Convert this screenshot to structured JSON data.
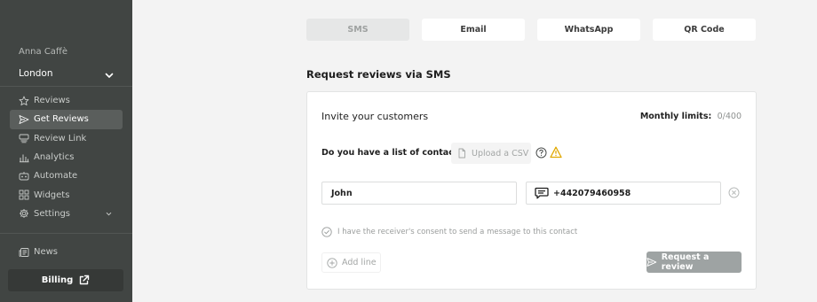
{
  "sidebar": {
    "company": "Anna Caffè",
    "location": "London",
    "items": [
      {
        "label": "Reviews",
        "icon": "star-icon"
      },
      {
        "label": "Get Reviews",
        "icon": "send-icon"
      },
      {
        "label": "Review Link",
        "icon": "review-link-icon"
      },
      {
        "label": "Analytics",
        "icon": "analytics-icon"
      },
      {
        "label": "Automate",
        "icon": "automate-icon"
      },
      {
        "label": "Widgets",
        "icon": "widgets-icon"
      },
      {
        "label": "Settings",
        "icon": "gear-icon"
      }
    ],
    "news": "News",
    "billing": "Billing"
  },
  "tabs": [
    "SMS",
    "Email",
    "WhatsApp",
    "QR Code"
  ],
  "section_title": "Request reviews via SMS",
  "card": {
    "title": "Invite your customers",
    "limits_label": "Monthly limits:",
    "limits_value": "0/400",
    "contacts_question": "Do you have a list of contacts?",
    "upload_label": "Upload a CSV",
    "name_value": "John",
    "phone_value": "+442079460958",
    "consent": "I have the receiver's consent to send a message to this contact",
    "add_line": "Add line",
    "request_button": "Request a review"
  },
  "colors": {
    "sidebar_bg": "#414543",
    "sidebar_active": "#5a5e5c",
    "page_bg": "#f3f3f3",
    "warning": "#e0a800",
    "button_disabled": "#9ea3a3"
  }
}
